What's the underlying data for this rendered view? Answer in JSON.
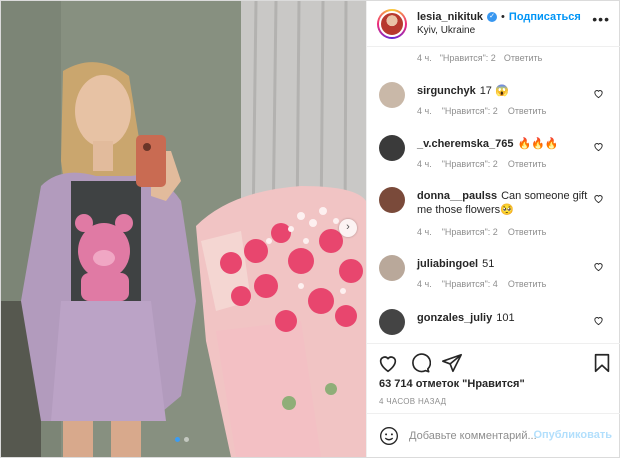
{
  "header": {
    "username": "lesia_nikituk",
    "separator": "•",
    "follow_label": "Подписаться",
    "location": "Kyiv, Ukraine",
    "more_glyph": "•••"
  },
  "previous_meta": {
    "time": "4 ч.",
    "likes": "\"Нравится\": 2",
    "reply": "Ответить"
  },
  "comments": [
    {
      "user": "sirgunchyk",
      "text": "17 😱",
      "time": "4 ч.",
      "likes": "\"Нравится\": 2",
      "reply": "Ответить",
      "avatar_color": "#c9b8a8"
    },
    {
      "user": "_v.cheremska_765",
      "text": "🔥🔥🔥",
      "time": "4 ч.",
      "likes": "\"Нравится\": 2",
      "reply": "Ответить",
      "avatar_color": "#3a3a3a"
    },
    {
      "user": "donna__paulss",
      "text": "Can someone gift me those flowers🥺",
      "time": "4 ч.",
      "likes": "\"Нравится\": 2",
      "reply": "Ответить",
      "avatar_color": "#7a4a3a"
    },
    {
      "user": "juliabingoel",
      "text": "51",
      "time": "4 ч.",
      "likes": "\"Нравится\": 4",
      "reply": "Ответить",
      "avatar_color": "#b9a89a"
    },
    {
      "user": "gonzales_juliy",
      "text": "101",
      "time": "",
      "likes": "",
      "reply": "",
      "avatar_color": "#444444"
    }
  ],
  "likes_text": "63 714 отметок \"Нравится\"",
  "time_ago": "4 ЧАСОВ НАЗАД",
  "add_comment": {
    "placeholder": "Добавьте комментарий...",
    "publish_label": "Опубликовать"
  },
  "carousel": {
    "next_glyph": "›",
    "total": 2,
    "current": 1
  },
  "icons": [
    "verified-icon",
    "more-icon",
    "heart-icon",
    "comment-icon",
    "share-icon",
    "bookmark-icon",
    "emoji-icon",
    "carousel-next-icon"
  ],
  "colors": {
    "accent": "#0095f6",
    "publish_disabled": "#b2dffc",
    "muted": "#8e8e8e",
    "text": "#262626"
  }
}
